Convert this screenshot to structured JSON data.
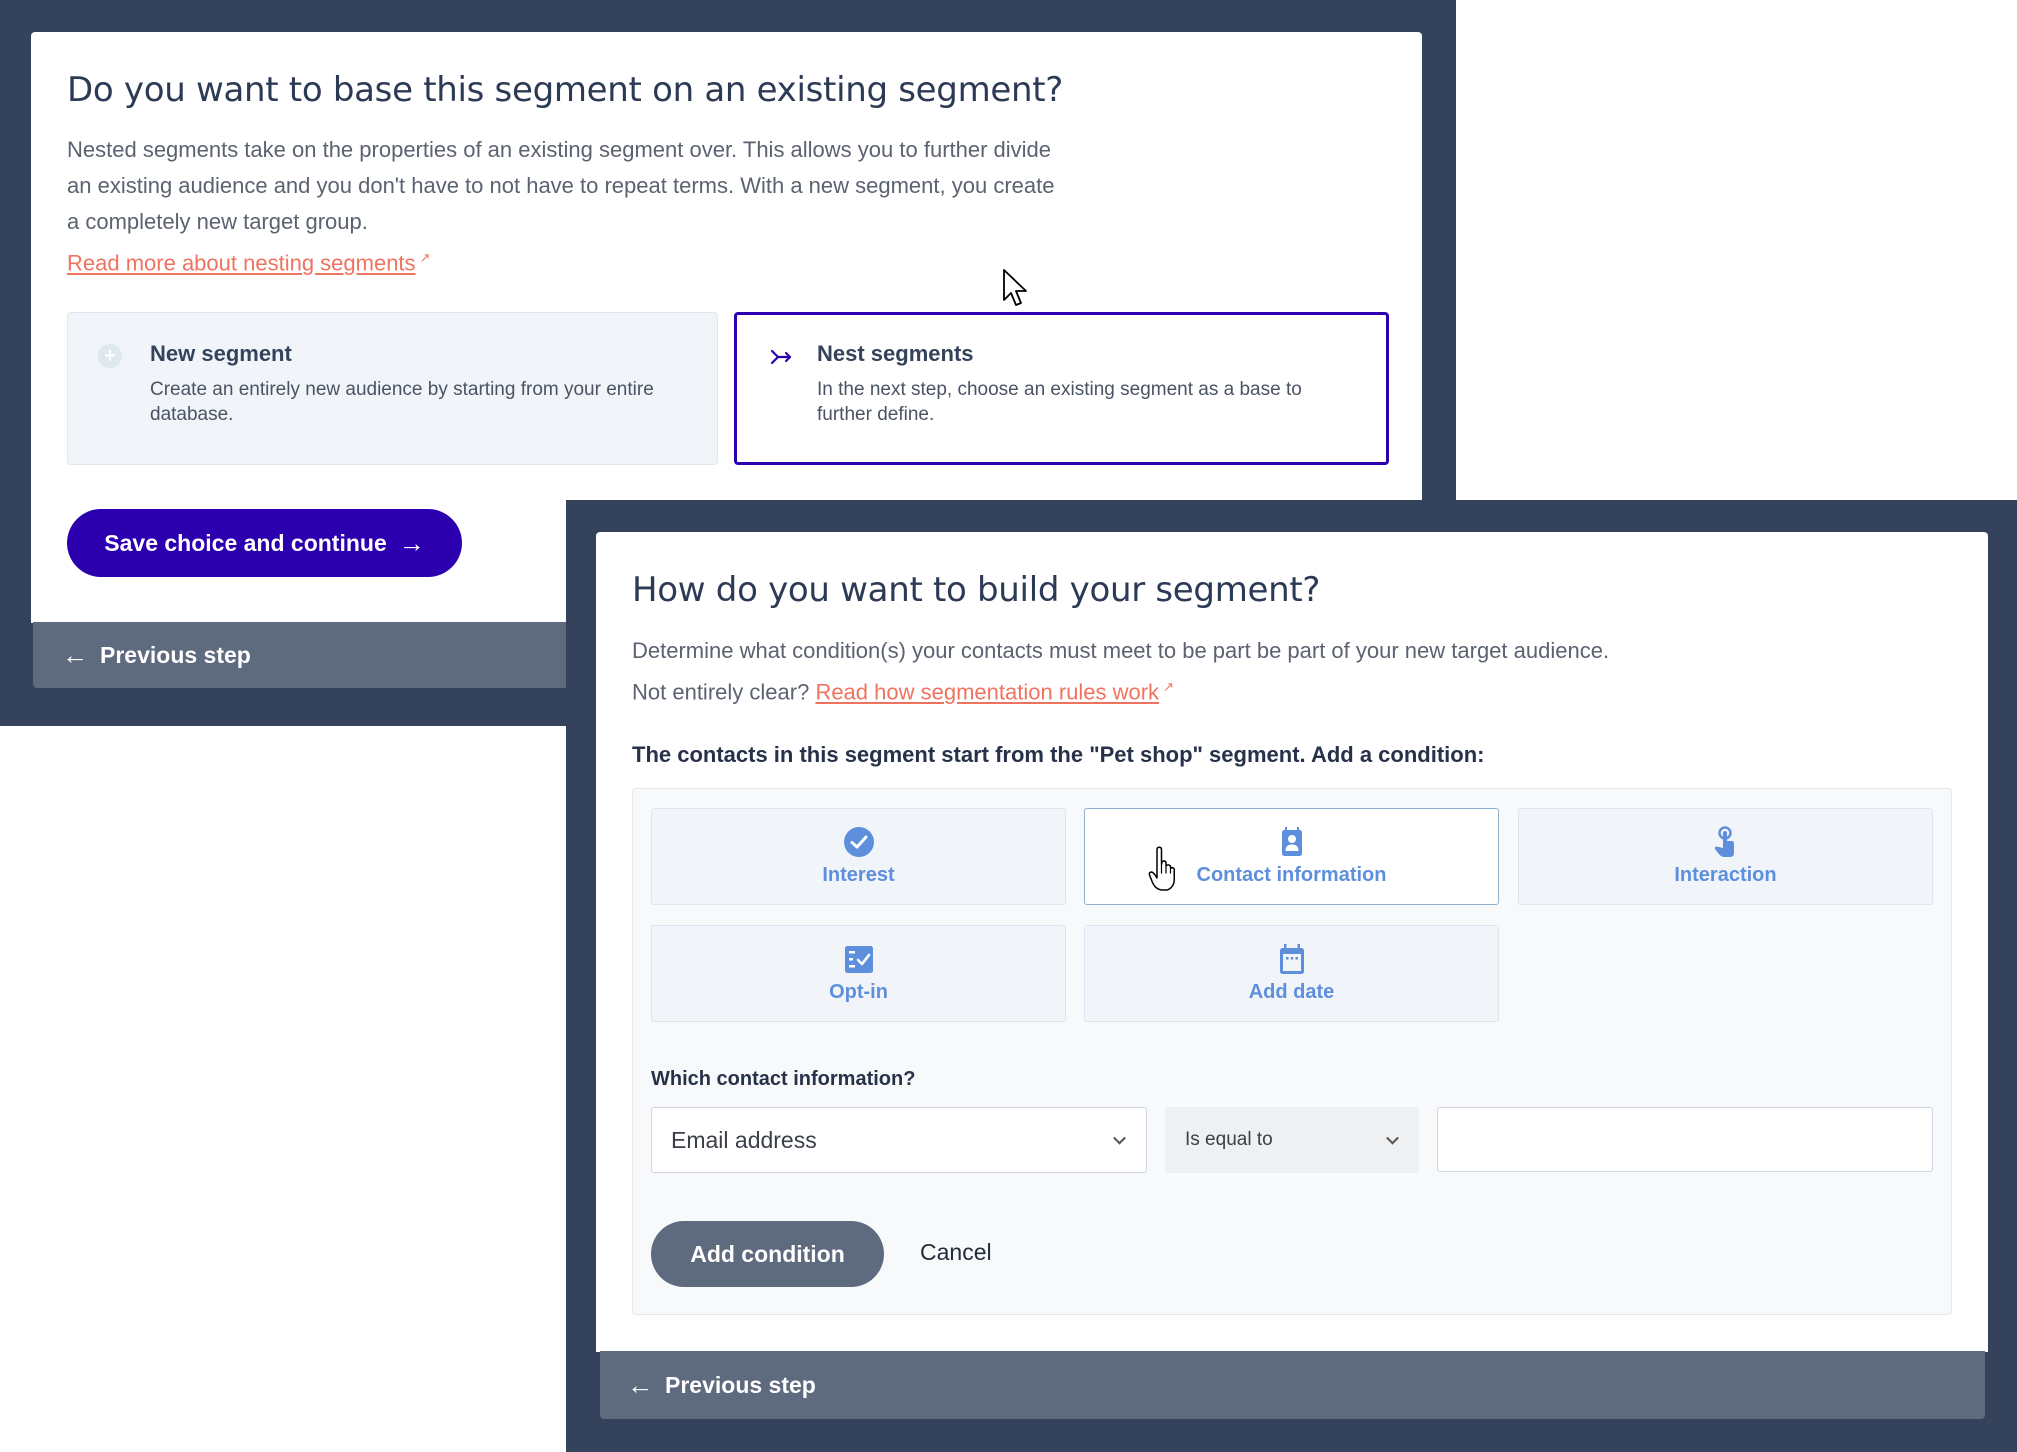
{
  "step1": {
    "title": "Do you want to base this segment on an existing segment?",
    "description": "Nested segments take on the properties of an existing segment over. This allows you to further divide an existing audience and you don't have to not have to repeat terms. With a new segment, you create a completely new target group.",
    "link_label": "Read more about nesting segments",
    "link_icon": "external-link-icon",
    "choices": [
      {
        "icon": "plus-circle-icon",
        "title": "New segment",
        "description": "Create an entirely new audience by starting from your entire database.",
        "selected": false
      },
      {
        "icon": "nest-arrow-icon",
        "title": "Nest segments",
        "description": "In the next step, choose an existing segment as a base to further define.",
        "selected": true
      }
    ],
    "save_button": "Save choice and continue",
    "save_arrow": "→",
    "previous_step": "Previous step",
    "previous_arrow": "←"
  },
  "step2": {
    "title": "How do you want to build your segment?",
    "description_prefix": "Determine what condition(s) your contacts must meet to be part be part of your new target audience. Not entirely clear?",
    "link_label": "Read how segmentation rules work",
    "link_icon": "external-link-icon",
    "start_line": "The contacts in this segment start from the \"Pet shop\" segment. Add a condition:",
    "condition_types": [
      {
        "label": "Interest",
        "icon": "check-circle-icon",
        "hovered": false
      },
      {
        "label": "Contact information",
        "icon": "contact-card-icon",
        "hovered": true
      },
      {
        "label": "Interaction",
        "icon": "tap-hand-icon",
        "hovered": false
      },
      {
        "label": "Opt-in",
        "icon": "checklist-icon",
        "hovered": false
      },
      {
        "label": "Add date",
        "icon": "calendar-icon",
        "hovered": false
      }
    ],
    "which_label": "Which contact information?",
    "field_select": {
      "value": "Email address"
    },
    "operator_select": {
      "value": "Is equal to"
    },
    "value_input": {
      "value": "",
      "placeholder": ""
    },
    "add_button": "Add condition",
    "cancel_button": "Cancel",
    "previous_step": "Previous step",
    "previous_arrow": "←"
  },
  "colors": {
    "frame": "#34435b",
    "primary": "#2c00ae",
    "link": "#f0735f",
    "tile_accent": "#5e8fdc",
    "footer": "#5e6a7d"
  }
}
